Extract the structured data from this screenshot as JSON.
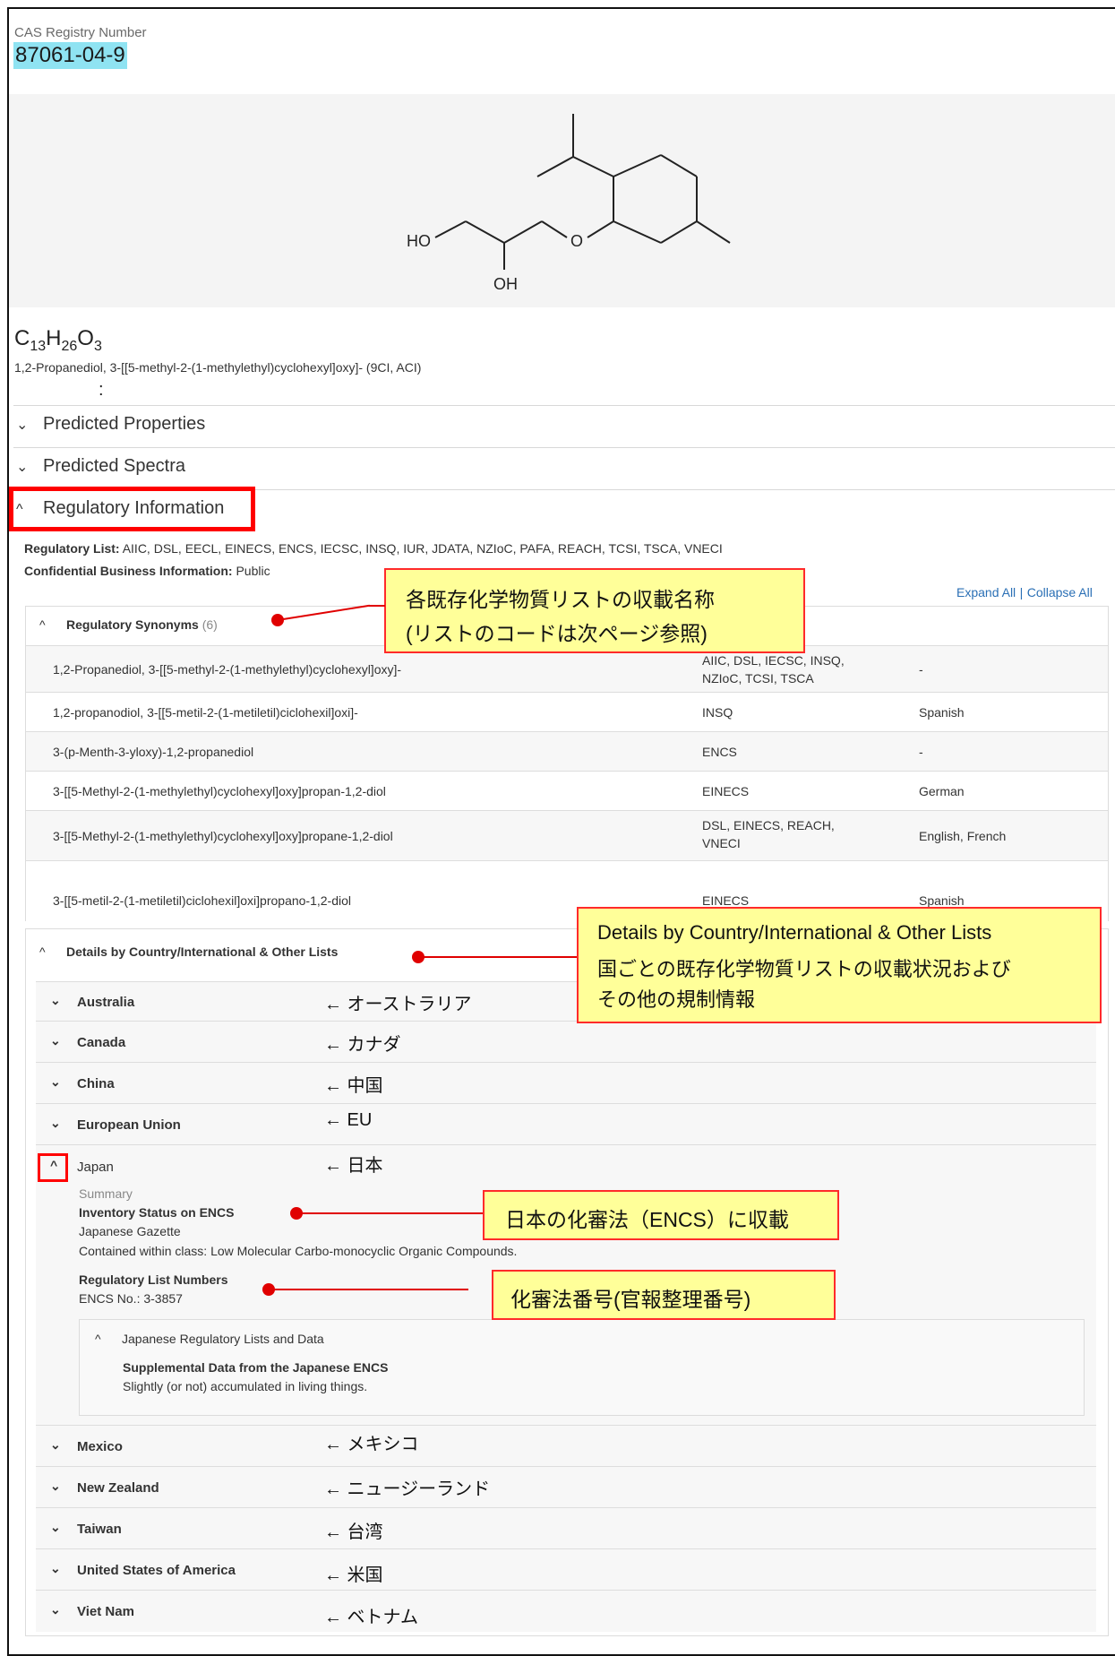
{
  "cas": {
    "label": "CAS Registry Number",
    "number": "87061-04-9"
  },
  "structure": {
    "atoms": {
      "ho": "HO",
      "oh": "OH",
      "o": "O"
    }
  },
  "formula": {
    "c": "C",
    "c_n": "13",
    "h": "H",
    "h_n": "26",
    "o": "O",
    "o_n": "3"
  },
  "name": "1,2-Propanediol, 3-[[5-methyl-2-(1-methylethyl)cyclohexyl]oxy]- (9CI, ACI)",
  "colon": ":",
  "sections": [
    {
      "label": "Predicted Properties",
      "icon": "chevron-down-icon",
      "symbol": "⌄"
    },
    {
      "label": "Predicted Spectra",
      "icon": "chevron-down-icon",
      "symbol": "⌄"
    },
    {
      "label": "Regulatory Information",
      "icon": "chevron-up-icon",
      "symbol": "^"
    }
  ],
  "regulatory": {
    "list_label": "Regulatory List:",
    "list_value": " AIIC, DSL, EECL, EINECS, ENCS, IECSC, INSQ, IUR, JDATA, NZIoC, PAFA, REACH, TCSI, TSCA, VNECI",
    "cbi_label": "Confidential Business Information:",
    "cbi_value": " Public",
    "expand_all": "Expand All",
    "separator": "|",
    "collapse_all": "Collapse All"
  },
  "synonyms": {
    "title": "Regulatory Synonyms",
    "count": "(6)",
    "rows": [
      {
        "name": "1,2-Propanediol, 3-[[5-methyl-2-(1-methylethyl)cyclohexyl]oxy]-",
        "lists": "AIIC, DSL, IECSC, INSQ, NZIoC, TCSI, TSCA",
        "lang": "-"
      },
      {
        "name": "1,2-propanodiol, 3-[[5-metil-2-(1-metiletil)ciclohexil]oxi]-",
        "lists": "INSQ",
        "lang": "Spanish"
      },
      {
        "name": "3-(p-Menth-3-yloxy)-1,2-propanediol",
        "lists": "ENCS",
        "lang": "-"
      },
      {
        "name": "3-[[5-Methyl-2-(1-methylethyl)cyclohexyl]oxy]propan-1,2-diol",
        "lists": "EINECS",
        "lang": "German"
      },
      {
        "name": "3-[[5-Methyl-2-(1-methylethyl)cyclohexyl]oxy]propane-1,2-diol",
        "lists": "DSL, EINECS, REACH, VNECI",
        "lang": "English, French"
      },
      {
        "name": "3-[[5-metil-2-(1-metiletil)ciclohexil]oxi]propano-1,2-diol",
        "lists": "EINECS",
        "lang": "Spanish"
      }
    ]
  },
  "details": {
    "title": "Details by Country/International & Other Lists",
    "countries": [
      {
        "name": "Australia",
        "annotation": "← オーストラリア"
      },
      {
        "name": "Canada",
        "annotation": "← カナダ"
      },
      {
        "name": "China",
        "annotation": "← 中国"
      },
      {
        "name": "European Union",
        "annotation": "← EU"
      },
      {
        "name": "Japan",
        "annotation": "← 日本"
      },
      {
        "name": "Mexico",
        "annotation": "← メキシコ"
      },
      {
        "name": "New Zealand",
        "annotation": "← ニュージーランド"
      },
      {
        "name": "Taiwan",
        "annotation": "← 台湾"
      },
      {
        "name": "United States of America",
        "annotation": "← 米国"
      },
      {
        "name": "Viet Nam",
        "annotation": "← ベトナム"
      }
    ],
    "japan": {
      "summary": "Summary",
      "inventory_title": "Inventory Status on ENCS",
      "gazette": "Japanese Gazette",
      "class": "Contained within class: Low Molecular Carbo-monocyclic Organic Compounds.",
      "numbers_title": "Regulatory List Numbers",
      "encs_no": "ENCS No.: 3-3857",
      "sub_title": "Japanese Regulatory Lists and Data",
      "supp_title": "Supplemental Data from the Japanese ENCS",
      "supp_text": "Slightly (or not) accumulated in living things."
    }
  },
  "notes": {
    "synonyms_line1": "各既存化学物質リストの収載名称",
    "synonyms_line2": "(リストのコードは次ページ参照)",
    "details_line1": "Details by Country/International & Other Lists",
    "details_line2": "国ごとの既存化学物質リストの収載状況および",
    "details_line3": "その他の規制情報",
    "encs": "日本の化審法（ENCS）に収載",
    "number": "化審法番号(官報整理番号)"
  },
  "colors": {
    "cas_highlight": "#8fe3f2",
    "note_bg": "#ffff99",
    "note_border": "#ff2a2a",
    "link": "#2a6fb5"
  }
}
